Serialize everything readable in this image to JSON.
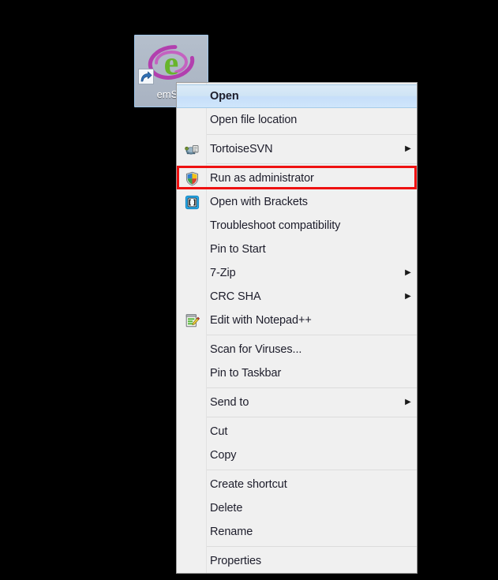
{
  "desktop": {
    "icon": {
      "label": "emSig",
      "name": "emsigner-shortcut-icon",
      "has_shortcut_overlay": true,
      "selected": true,
      "glyph_letter": "e",
      "glyph_color": "#67b52b",
      "ring_color": "#b23fae",
      "selection_fill": "#aeb8c6",
      "selection_border": "#9ec6ea",
      "label_color": "#ffffff"
    },
    "background_color": "#000000"
  },
  "context_menu": {
    "name": "file-context-menu",
    "background": "#f0f0f0",
    "border_color": "#9e9e9e",
    "highlight_color": "#cfe4f5",
    "highlight_border": "#a6cbe8",
    "text_color": "#1d1d2b",
    "separator_color": "#dcdcdc",
    "annotation": {
      "box_color": "#ee1111",
      "target_item": "Run as administrator"
    },
    "items": [
      {
        "label": "Open",
        "icon": "",
        "submenu": false,
        "bold": true,
        "highlighted": true
      },
      {
        "label": "Open file location",
        "icon": "",
        "submenu": false,
        "bold": false,
        "highlighted": false
      },
      {
        "separator": true
      },
      {
        "label": "TortoiseSVN",
        "icon": "tortoise-svn-icon",
        "submenu": true,
        "bold": false,
        "highlighted": false
      },
      {
        "separator": true
      },
      {
        "label": "Run as administrator",
        "icon": "uac-shield-icon",
        "submenu": false,
        "bold": false,
        "highlighted": false,
        "annotated": true
      },
      {
        "label": "Open with Brackets",
        "icon": "brackets-icon",
        "submenu": false,
        "bold": false,
        "highlighted": false
      },
      {
        "label": "Troubleshoot compatibility",
        "icon": "",
        "submenu": false,
        "bold": false,
        "highlighted": false
      },
      {
        "label": "Pin to Start",
        "icon": "",
        "submenu": false,
        "bold": false,
        "highlighted": false
      },
      {
        "label": "7-Zip",
        "icon": "",
        "submenu": true,
        "bold": false,
        "highlighted": false
      },
      {
        "label": "CRC SHA",
        "icon": "",
        "submenu": true,
        "bold": false,
        "highlighted": false
      },
      {
        "label": "Edit with Notepad++",
        "icon": "notepad-plus-plus-icon",
        "submenu": false,
        "bold": false,
        "highlighted": false
      },
      {
        "separator": true
      },
      {
        "label": "Scan for Viruses...",
        "icon": "",
        "submenu": false,
        "bold": false,
        "highlighted": false
      },
      {
        "label": "Pin to Taskbar",
        "icon": "",
        "submenu": false,
        "bold": false,
        "highlighted": false
      },
      {
        "separator": true
      },
      {
        "label": "Send to",
        "icon": "",
        "submenu": true,
        "bold": false,
        "highlighted": false
      },
      {
        "separator": true
      },
      {
        "label": "Cut",
        "icon": "",
        "submenu": false,
        "bold": false,
        "highlighted": false
      },
      {
        "label": "Copy",
        "icon": "",
        "submenu": false,
        "bold": false,
        "highlighted": false
      },
      {
        "separator": true
      },
      {
        "label": "Create shortcut",
        "icon": "",
        "submenu": false,
        "bold": false,
        "highlighted": false
      },
      {
        "label": "Delete",
        "icon": "",
        "submenu": false,
        "bold": false,
        "highlighted": false
      },
      {
        "label": "Rename",
        "icon": "",
        "submenu": false,
        "bold": false,
        "highlighted": false
      },
      {
        "separator": true
      },
      {
        "label": "Properties",
        "icon": "",
        "submenu": false,
        "bold": false,
        "highlighted": false
      }
    ],
    "submenu_arrow_glyph": "▶"
  }
}
